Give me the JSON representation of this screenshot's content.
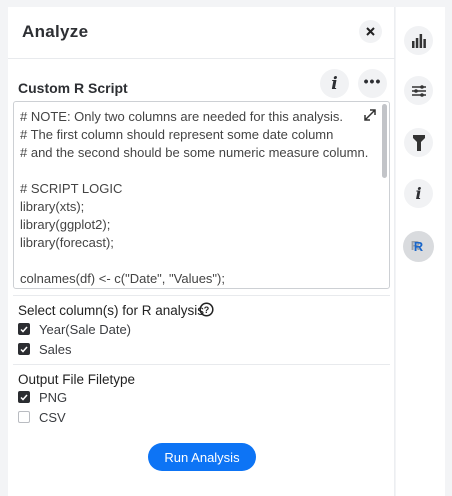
{
  "header": {
    "title": "Analyze",
    "close_icon": "close-icon"
  },
  "script": {
    "title": "Custom R Script",
    "info_icon": "info-icon",
    "more_icon": "more-icon",
    "code": "# NOTE: Only two columns are needed for this analysis.\n# The first column should represent some date column\n# and the second should be some numeric measure column.\n\n# SCRIPT LOGIC\nlibrary(xts);\nlibrary(ggplot2);\nlibrary(forecast);\n\ncolnames(df) <- c(\"Date\", \"Values\");"
  },
  "columns": {
    "title": "Select column(s) for R analysis",
    "items": [
      {
        "label": "Year(Sale Date)",
        "checked": true
      },
      {
        "label": "Sales",
        "checked": true
      }
    ]
  },
  "output": {
    "title": "Output File Filetype",
    "items": [
      {
        "label": "PNG",
        "checked": true
      },
      {
        "label": "CSV",
        "checked": false
      }
    ]
  },
  "run_label": "Run Analysis",
  "rail": [
    "chart-icon",
    "settings-icon",
    "filter-icon",
    "info-icon",
    "r-icon"
  ],
  "colors": {
    "accent": "#0d74f5"
  }
}
